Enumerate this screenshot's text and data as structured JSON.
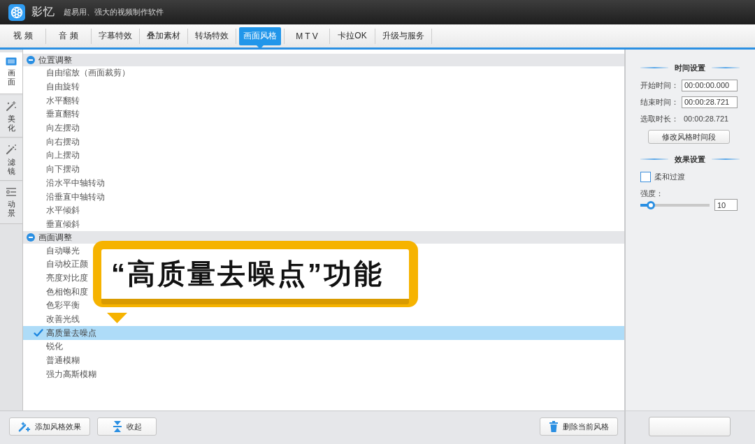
{
  "window": {
    "title": "影忆",
    "subtitle": "超易用、强大的视频制作软件"
  },
  "tabs": [
    {
      "label": "视 频",
      "selected": false
    },
    {
      "label": "音 频",
      "selected": false
    },
    {
      "label": "字幕特效",
      "selected": false
    },
    {
      "label": "叠加素材",
      "selected": false
    },
    {
      "label": "转场特效",
      "selected": false
    },
    {
      "label": "画面风格",
      "selected": true
    },
    {
      "label": "M T V",
      "selected": false
    },
    {
      "label": "卡拉OK",
      "selected": false
    },
    {
      "label": "升级与服务",
      "selected": false
    }
  ],
  "side_tabs": [
    {
      "label": "画面",
      "selected": true
    },
    {
      "label": "美化",
      "selected": false
    },
    {
      "label": "滤镜",
      "selected": false
    },
    {
      "label": "动景",
      "selected": false
    }
  ],
  "effect_groups": [
    {
      "title": "位置调整",
      "expanded": true,
      "items": [
        {
          "label": "自由缩放（画面裁剪）",
          "selected": false,
          "checked": false
        },
        {
          "label": "自由旋转",
          "selected": false,
          "checked": false
        },
        {
          "label": "水平翻转",
          "selected": false,
          "checked": false
        },
        {
          "label": "垂直翻转",
          "selected": false,
          "checked": false
        },
        {
          "label": "向左摆动",
          "selected": false,
          "checked": false
        },
        {
          "label": "向右摆动",
          "selected": false,
          "checked": false
        },
        {
          "label": "向上摆动",
          "selected": false,
          "checked": false
        },
        {
          "label": "向下摆动",
          "selected": false,
          "checked": false
        },
        {
          "label": "沿水平中轴转动",
          "selected": false,
          "checked": false
        },
        {
          "label": "沿垂直中轴转动",
          "selected": false,
          "checked": false
        },
        {
          "label": "水平倾斜",
          "selected": false,
          "checked": false
        },
        {
          "label": "垂直倾斜",
          "selected": false,
          "checked": false
        }
      ]
    },
    {
      "title": "画面调整",
      "expanded": true,
      "items": [
        {
          "label": "自动曝光",
          "selected": false,
          "checked": false
        },
        {
          "label": "自动校正颜",
          "selected": false,
          "checked": false
        },
        {
          "label": "亮度对比度",
          "selected": false,
          "checked": false
        },
        {
          "label": "色相饱和度",
          "selected": false,
          "checked": false
        },
        {
          "label": "色彩平衡",
          "selected": false,
          "checked": false
        },
        {
          "label": "改善光线",
          "selected": false,
          "checked": false
        },
        {
          "label": "高质量去噪点",
          "selected": true,
          "checked": true
        },
        {
          "label": "锐化",
          "selected": false,
          "checked": false
        },
        {
          "label": "普通模糊",
          "selected": false,
          "checked": false
        },
        {
          "label": "强力高斯模糊",
          "selected": false,
          "checked": false
        }
      ]
    }
  ],
  "callout": {
    "text": "“高质量去噪点”功能"
  },
  "time_settings": {
    "title": "时间设置",
    "start": {
      "label": "开始时间：",
      "value": "00:00:00.000"
    },
    "end": {
      "label": "结束时间：",
      "value": "00:00:28.721"
    },
    "duration": {
      "label": "选取时长：",
      "value": "00:00:28.721"
    },
    "button": "修改风格时间段"
  },
  "effect_settings": {
    "title": "效果设置",
    "soft_transition": {
      "label": "柔和过渡",
      "checked": false
    },
    "strength": {
      "label": "强度：",
      "level": 0.1,
      "value": "10"
    }
  },
  "bottom_bar": {
    "left_buttons": [
      "添加风格效果",
      "收起"
    ],
    "right_buttons": [
      "删除当前风格"
    ]
  }
}
